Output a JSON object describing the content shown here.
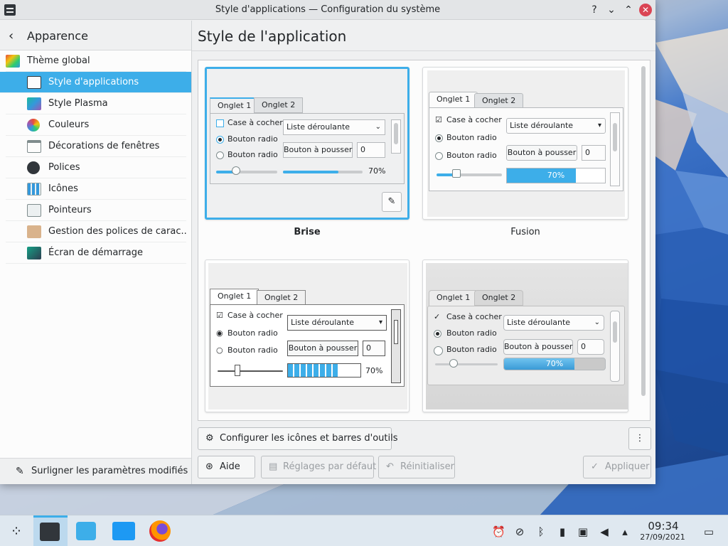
{
  "window": {
    "title": "Style d'applications — Configuration du système",
    "controls": {
      "help": "?",
      "minimize": "⌄",
      "maximize": "⌃",
      "close": "✕"
    }
  },
  "sidebar": {
    "back_label": "Apparence",
    "items": [
      {
        "label": "Thème global",
        "icon": "global-theme-icon",
        "top": true
      },
      {
        "label": "Style d'applications",
        "icon": "app-style-icon",
        "active": true
      },
      {
        "label": "Style Plasma",
        "icon": "plasma-style-icon"
      },
      {
        "label": "Couleurs",
        "icon": "colors-icon"
      },
      {
        "label": "Décorations de fenêtres",
        "icon": "window-decorations-icon"
      },
      {
        "label": "Polices",
        "icon": "fonts-icon"
      },
      {
        "label": "Icônes",
        "icon": "icons-icon"
      },
      {
        "label": "Pointeurs",
        "icon": "cursors-icon"
      },
      {
        "label": "Gestion des polices de carac...",
        "icon": "font-management-icon"
      },
      {
        "label": "Écran de démarrage",
        "icon": "splash-screen-icon"
      }
    ],
    "footer_label": "Surligner les paramètres modifiés"
  },
  "main": {
    "title": "Style de l'application",
    "styles": [
      {
        "name": "Brise",
        "selected": true
      },
      {
        "name": "Fusion",
        "selected": false
      },
      {
        "name": "",
        "selected": false
      },
      {
        "name": "",
        "selected": false
      }
    ],
    "preview": {
      "tab1": "Onglet 1",
      "tab2": "Onglet 2",
      "checkbox": "Case à cocher",
      "radio": "Bouton radio",
      "combo": "Liste déroulante",
      "push": "Bouton à pousser",
      "spin": "0",
      "progress_text": "70%",
      "progress": 0.7
    },
    "configure_button": "Configurer les icônes et barres d'outils",
    "more_button": "⋮"
  },
  "bottom_buttons": {
    "help": "Aide",
    "defaults": "Réglages par défaut",
    "reset": "Réinitialiser",
    "apply": "Appliquer"
  },
  "taskbar": {
    "time": "09:34",
    "date": "27/09/2021"
  },
  "colors": {
    "accent": "#3daee9",
    "close": "#da4453"
  }
}
